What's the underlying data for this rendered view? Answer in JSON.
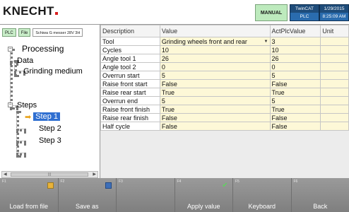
{
  "header": {
    "logo": "KNECHT",
    "mode": "MANUAL",
    "twincat": "TwinCAT",
    "plc": "PLC",
    "date": "1/29/2015",
    "time": "8:25:09 AM"
  },
  "left": {
    "chips": [
      "PLC",
      "File"
    ],
    "machine_name": "Schiwa G messer 28V 3H",
    "tree": {
      "root": "Processing",
      "data": "Data",
      "grinding": "Grinding medium",
      "steps": "Steps",
      "step1": "Step 1",
      "step2": "Step 2",
      "step3": "Step 3"
    }
  },
  "table": {
    "headers": {
      "description": "Description",
      "value": "Value",
      "act": "ActPlcValue",
      "unit": "Unit"
    },
    "rows": [
      {
        "description": "Tool",
        "value": "Grinding wheels front and rear",
        "act": "3",
        "unit": ""
      },
      {
        "description": "Cycles",
        "value": "10",
        "act": "10",
        "unit": ""
      },
      {
        "description": "Angle tool 1",
        "value": "26",
        "act": "26",
        "unit": ""
      },
      {
        "description": "Angle tool 2",
        "value": "0",
        "act": "0",
        "unit": ""
      },
      {
        "description": "Overrun start",
        "value": "5",
        "act": "5",
        "unit": ""
      },
      {
        "description": "Raise front start",
        "value": "False",
        "act": "False",
        "unit": ""
      },
      {
        "description": "Raise rear start",
        "value": "True",
        "act": "True",
        "unit": ""
      },
      {
        "description": "Overrun end",
        "value": "5",
        "act": "5",
        "unit": ""
      },
      {
        "description": "Raise front finish",
        "value": "True",
        "act": "True",
        "unit": ""
      },
      {
        "description": "Raise rear finish",
        "value": "False",
        "act": "False",
        "unit": ""
      },
      {
        "description": "Half cycle",
        "value": "False",
        "act": "False",
        "unit": ""
      }
    ]
  },
  "footer": {
    "keys": [
      {
        "num": "F1",
        "label": "Load from file"
      },
      {
        "num": "F2",
        "label": "Save as"
      },
      {
        "num": "F3",
        "label": ""
      },
      {
        "num": "F4",
        "label": "Apply value"
      },
      {
        "num": "F5",
        "label": "Keyboard"
      },
      {
        "num": "F6",
        "label": "Back"
      }
    ]
  }
}
